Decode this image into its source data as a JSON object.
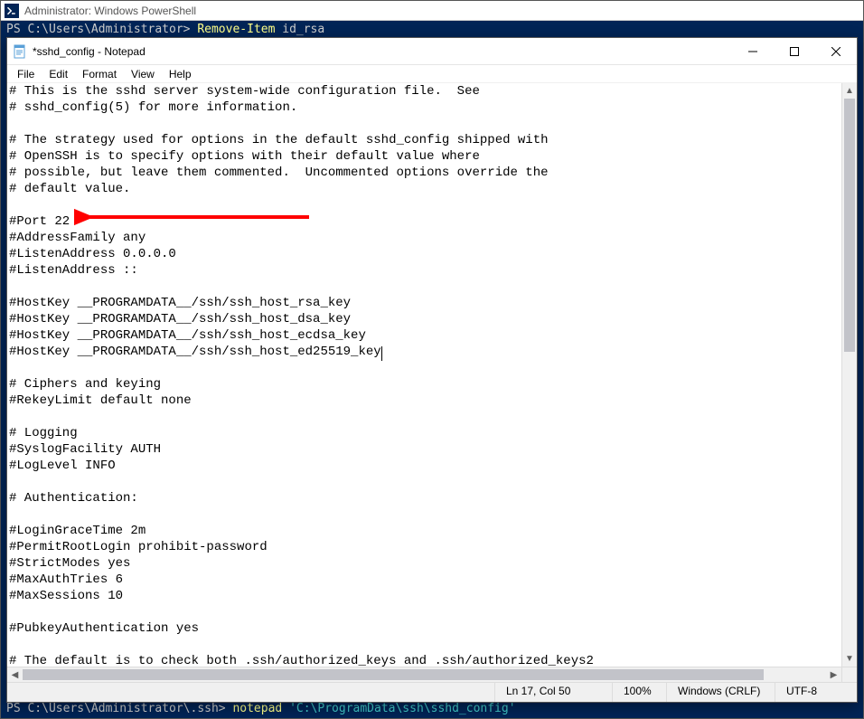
{
  "powershell": {
    "title": "Administrator: Windows PowerShell",
    "line1_prompt": "PS C:\\Users\\Administrator> ",
    "line1_cmd": "Remove-Item",
    "line1_arg": " id_rsa",
    "bottom_blank": "",
    "bottom_prompt": "PS C:\\Users\\Administrator\\.ssh> ",
    "bottom_cmd": "notepad ",
    "bottom_str": "'C:\\ProgramData\\ssh\\sshd_config'"
  },
  "notepad": {
    "title": "*sshd_config - Notepad",
    "menu": {
      "file": "File",
      "edit": "Edit",
      "format": "Format",
      "view": "View",
      "help": "Help"
    },
    "content_before_caret": "# This is the sshd server system-wide configuration file.  See\n# sshd_config(5) for more information.\n\n# The strategy used for options in the default sshd_config shipped with\n# OpenSSH is to specify options with their default value where\n# possible, but leave them commented.  Uncommented options override the\n# default value.\n\n#Port 22\n#AddressFamily any\n#ListenAddress 0.0.0.0\n#ListenAddress ::\n\n#HostKey __PROGRAMDATA__/ssh/ssh_host_rsa_key\n#HostKey __PROGRAMDATA__/ssh/ssh_host_dsa_key\n#HostKey __PROGRAMDATA__/ssh/ssh_host_ecdsa_key\n#HostKey __PROGRAMDATA__/ssh/ssh_host_ed25519_key",
    "content_after_caret": "\n\n# Ciphers and keying\n#RekeyLimit default none\n\n# Logging\n#SyslogFacility AUTH\n#LogLevel INFO\n\n# Authentication:\n\n#LoginGraceTime 2m\n#PermitRootLogin prohibit-password\n#StrictModes yes\n#MaxAuthTries 6\n#MaxSessions 10\n\n#PubkeyAuthentication yes\n\n# The default is to check both .ssh/authorized_keys and .ssh/authorized_keys2",
    "status": {
      "lncol": "Ln 17, Col 50",
      "zoom": "100%",
      "eol": "Windows (CRLF)",
      "enc": "UTF-8"
    }
  },
  "annotation": {
    "target_line": "#Port 22"
  }
}
